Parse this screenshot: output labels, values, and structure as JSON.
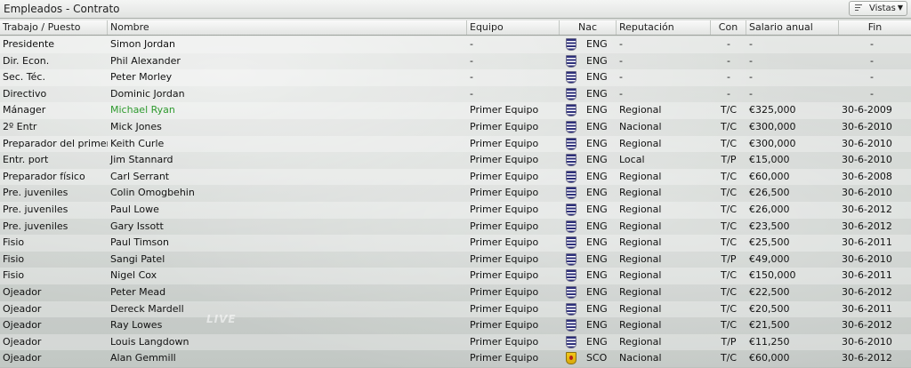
{
  "window": {
    "title": "Empleados - Contrato",
    "views_label": "Vistas"
  },
  "columns": {
    "role": "Trabajo / Puesto",
    "name": "Nombre",
    "team": "Equipo",
    "nat": "Nac",
    "rep": "Reputación",
    "con": "Con",
    "salary": "Salario anual",
    "end": "Fin"
  },
  "watermark": "LIVE",
  "rows": [
    {
      "role": "Presidente",
      "name": "Simon Jordan",
      "team": "-",
      "flag": "england-flag-icon",
      "nat": "ENG",
      "rep": "-",
      "con": "-",
      "salary": "-",
      "end": "-"
    },
    {
      "role": "Dir. Econ.",
      "name": "Phil Alexander",
      "team": "-",
      "flag": "england-flag-icon",
      "nat": "ENG",
      "rep": "-",
      "con": "-",
      "salary": "-",
      "end": "-"
    },
    {
      "role": "Sec. Téc.",
      "name": "Peter Morley",
      "team": "-",
      "flag": "england-flag-icon",
      "nat": "ENG",
      "rep": "-",
      "con": "-",
      "salary": "-",
      "end": "-"
    },
    {
      "role": "Directivo",
      "name": "Dominic Jordan",
      "team": "-",
      "flag": "england-flag-icon",
      "nat": "ENG",
      "rep": "-",
      "con": "-",
      "salary": "-",
      "end": "-"
    },
    {
      "role": "Mánager",
      "name": "Michael Ryan",
      "team": "Primer Equipo",
      "flag": "england-flag-icon",
      "nat": "ENG",
      "rep": "Regional",
      "con": "T/C",
      "salary": "€325,000",
      "end": "30-6-2009",
      "highlight": true
    },
    {
      "role": "2º Entr",
      "name": "Mick Jones",
      "team": "Primer Equipo",
      "flag": "england-flag-icon",
      "nat": "ENG",
      "rep": "Nacional",
      "con": "T/C",
      "salary": "€300,000",
      "end": "30-6-2010"
    },
    {
      "role": "Preparador del primer ...",
      "name": "Keith Curle",
      "team": "Primer Equipo",
      "flag": "england-flag-icon",
      "nat": "ENG",
      "rep": "Regional",
      "con": "T/C",
      "salary": "€300,000",
      "end": "30-6-2010"
    },
    {
      "role": "Entr. port",
      "name": "Jim Stannard",
      "team": "Primer Equipo",
      "flag": "england-flag-icon",
      "nat": "ENG",
      "rep": "Local",
      "con": "T/P",
      "salary": "€15,000",
      "end": "30-6-2010"
    },
    {
      "role": "Preparador físico",
      "name": "Carl Serrant",
      "team": "Primer Equipo",
      "flag": "england-flag-icon",
      "nat": "ENG",
      "rep": "Regional",
      "con": "T/C",
      "salary": "€60,000",
      "end": "30-6-2008"
    },
    {
      "role": "Pre. juveniles",
      "name": "Colin Omogbehin",
      "team": "Primer Equipo",
      "flag": "england-flag-icon",
      "nat": "ENG",
      "rep": "Regional",
      "con": "T/C",
      "salary": "€26,500",
      "end": "30-6-2010"
    },
    {
      "role": "Pre. juveniles",
      "name": "Paul Lowe",
      "team": "Primer Equipo",
      "flag": "england-flag-icon",
      "nat": "ENG",
      "rep": "Regional",
      "con": "T/C",
      "salary": "€26,000",
      "end": "30-6-2012"
    },
    {
      "role": "Pre. juveniles",
      "name": "Gary Issott",
      "team": "Primer Equipo",
      "flag": "england-flag-icon",
      "nat": "ENG",
      "rep": "Regional",
      "con": "T/C",
      "salary": "€23,500",
      "end": "30-6-2012"
    },
    {
      "role": "Fisio",
      "name": "Paul Timson",
      "team": "Primer Equipo",
      "flag": "england-flag-icon",
      "nat": "ENG",
      "rep": "Regional",
      "con": "T/C",
      "salary": "€25,500",
      "end": "30-6-2011"
    },
    {
      "role": "Fisio",
      "name": "Sangi Patel",
      "team": "Primer Equipo",
      "flag": "england-flag-icon",
      "nat": "ENG",
      "rep": "Regional",
      "con": "T/P",
      "salary": "€49,000",
      "end": "30-6-2010"
    },
    {
      "role": "Fisio",
      "name": "Nigel Cox",
      "team": "Primer Equipo",
      "flag": "england-flag-icon",
      "nat": "ENG",
      "rep": "Regional",
      "con": "T/C",
      "salary": "€150,000",
      "end": "30-6-2011"
    },
    {
      "role": "Ojeador",
      "name": "Peter Mead",
      "team": "Primer Equipo",
      "flag": "england-flag-icon",
      "nat": "ENG",
      "rep": "Regional",
      "con": "T/C",
      "salary": "€22,500",
      "end": "30-6-2012"
    },
    {
      "role": "Ojeador",
      "name": "Dereck Mardell",
      "team": "Primer Equipo",
      "flag": "england-flag-icon",
      "nat": "ENG",
      "rep": "Regional",
      "con": "T/C",
      "salary": "€20,500",
      "end": "30-6-2011"
    },
    {
      "role": "Ojeador",
      "name": "Ray Lowes",
      "team": "Primer Equipo",
      "flag": "england-flag-icon",
      "nat": "ENG",
      "rep": "Regional",
      "con": "T/C",
      "salary": "€21,500",
      "end": "30-6-2012"
    },
    {
      "role": "Ojeador",
      "name": "Louis Langdown",
      "team": "Primer Equipo",
      "flag": "england-flag-icon",
      "nat": "ENG",
      "rep": "Regional",
      "con": "T/P",
      "salary": "€11,250",
      "end": "30-6-2010"
    },
    {
      "role": "Ojeador",
      "name": "Alan Gemmill",
      "team": "Primer Equipo",
      "flag": "scotland-flag-icon",
      "nat": "SCO",
      "rep": "Nacional",
      "con": "T/C",
      "salary": "€60,000",
      "end": "30-6-2012"
    }
  ],
  "colors": {
    "highlight": "#2e9a2e",
    "header_bg": "#e2e4e2"
  }
}
